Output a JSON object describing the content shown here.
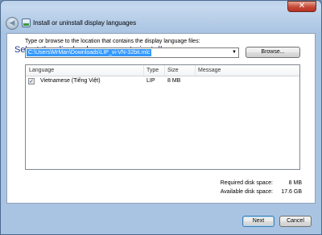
{
  "window": {
    "title": "Install or uninstall display languages",
    "close_label": "✕",
    "back_label": "◀"
  },
  "main": {
    "heading": "Select the display languages to install",
    "instruction": "Type or browse to the location that contains the display language files:",
    "path_value": "C:\\Users\\MrMan\\Downloads\\LIP_vi-VN-32bit.mlc",
    "browse_label": "Browse..."
  },
  "list": {
    "columns": [
      "Language",
      "Type",
      "Size",
      "Message"
    ],
    "rows": [
      {
        "checked": true,
        "language": "Vietnamese (Tiếng Việt)",
        "type": "LIP",
        "size": "8 MB",
        "message": ""
      }
    ]
  },
  "summary": {
    "required_label": "Required disk space:",
    "required_value": "8 MB",
    "available_label": "Available disk space:",
    "available_value": "17.6 GB"
  },
  "footer": {
    "next_label": "Next",
    "cancel_label": "Cancel"
  }
}
